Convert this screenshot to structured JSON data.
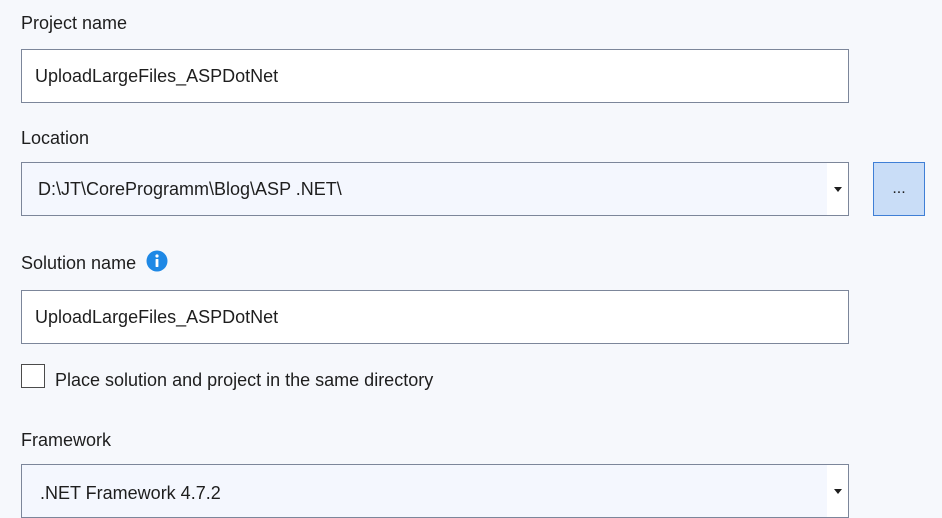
{
  "project_name": {
    "label": "Project name",
    "value": "UploadLargeFiles_ASPDotNet"
  },
  "location": {
    "label": "Location",
    "value": "D:\\JT\\CoreProgramm\\Blog\\ASP .NET\\",
    "browse_label": "..."
  },
  "solution_name": {
    "label": "Solution name",
    "value": "UploadLargeFiles_ASPDotNet",
    "info_icon": "info-icon"
  },
  "same_directory": {
    "label": "Place solution and project in the same directory",
    "checked": false
  },
  "framework": {
    "label": "Framework",
    "value": ".NET Framework 4.7.2"
  },
  "colors": {
    "background": "#f6f8fc",
    "field_border": "#7c869a",
    "accent": "#1e88e5",
    "browse_bg": "#c9ddf7",
    "browse_border": "#3f7fd6"
  }
}
